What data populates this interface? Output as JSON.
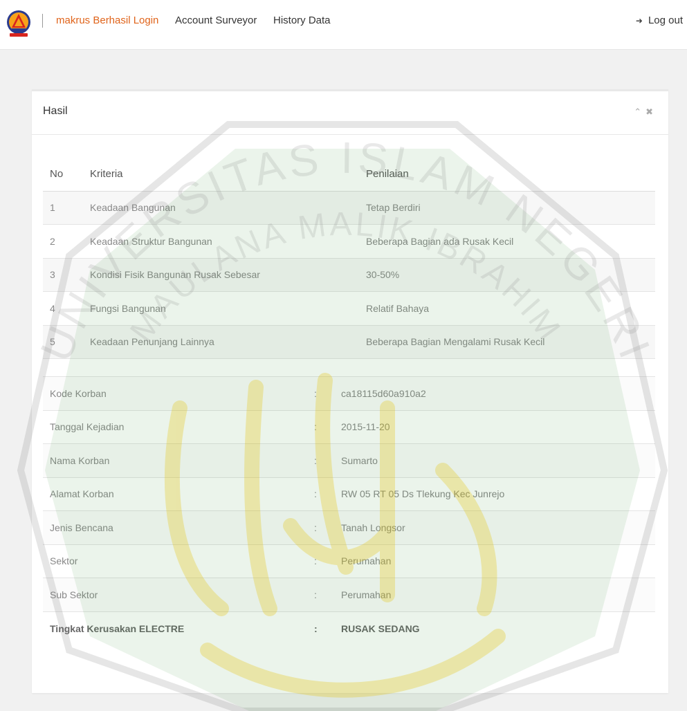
{
  "nav": {
    "brand": "makrus Berhasil Login",
    "account": "Account Surveyor",
    "history": "History Data",
    "logout": "Log out"
  },
  "panel": {
    "title": "Hasil",
    "collapse_icon": "chevron-up-icon",
    "close_icon": "close-icon"
  },
  "kriteria": {
    "headers": {
      "no": "No",
      "kriteria": "Kriteria",
      "penilaian": "Penilaian"
    },
    "rows": [
      {
        "no": "1",
        "kriteria": "Keadaan Bangunan",
        "penilaian": "Tetap Berdiri"
      },
      {
        "no": "2",
        "kriteria": "Keadaan Struktur Bangunan",
        "penilaian": "Beberapa Bagian ada Rusak Kecil"
      },
      {
        "no": "3",
        "kriteria": "Kondisi Fisik Bangunan Rusak Sebesar",
        "penilaian": "30-50%"
      },
      {
        "no": "4",
        "kriteria": "Fungsi Bangunan",
        "penilaian": "Relatif Bahaya"
      },
      {
        "no": "5",
        "kriteria": "Keadaan Penunjang Lainnya",
        "penilaian": "Beberapa Bagian Mengalami Rusak Kecil"
      }
    ]
  },
  "detail": {
    "separator": ":",
    "rows": [
      {
        "label": "Kode Korban",
        "value": "ca18115d60a910a2"
      },
      {
        "label": "Tanggal Kejadian",
        "value": "2015-11-20"
      },
      {
        "label": "Nama Korban",
        "value": "Sumarto"
      },
      {
        "label": "Alamat Korban",
        "value": "RW 05 RT 05 Ds Tlekung Kec Junrejo"
      },
      {
        "label": "Jenis Bencana",
        "value": "Tanah Longsor"
      },
      {
        "label": "Sektor",
        "value": "Perumahan"
      },
      {
        "label": "Sub Sektor",
        "value": "Perumahan"
      },
      {
        "label": "Tingkat Kerusakan ELECTRE",
        "value": "RUSAK SEDANG"
      }
    ]
  },
  "watermark": {
    "text_top": "UNIVERSITAS ISLAM NEGERI",
    "text_inner": "MAULANA MALIK IBRAHIM"
  },
  "colors": {
    "brand": "#e0641b",
    "watermark_green": "#3a8f3a",
    "watermark_gold": "#e6c200"
  }
}
